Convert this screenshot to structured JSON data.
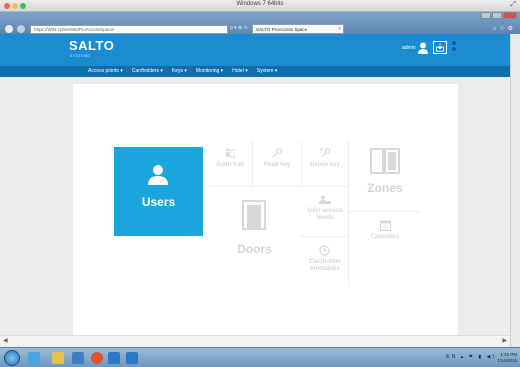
{
  "os": {
    "window_title": "Windows 7 64bits"
  },
  "browser": {
    "address": "https://WIN-zphee060/ProAccessSpace/",
    "address_tools": "ρ ▾ ⊗ ↻",
    "tab_title": "SALTO ProAccess Space",
    "tab_close": "×"
  },
  "header": {
    "logo": "SALTO",
    "logo_sub": "SYSTEMS",
    "user_name": "admin"
  },
  "menu": {
    "items": [
      "Access points ▾",
      "Cardholders ▾",
      "Keys ▾",
      "Monitoring ▾",
      "Hotel ▾",
      "System ▾"
    ]
  },
  "dashboard": {
    "users": "Users",
    "audit_trail": "Audit trail",
    "read_key": "Read key",
    "delete_key": "Delete key",
    "zones": "Zones",
    "doors": "Doors",
    "user_access_levels": "User access levels",
    "calendars": "Calendars",
    "cardholder_timetables": "Cardholder timetables"
  },
  "taskbar": {
    "tray": "EN ▴ ⚑ ▮ ◀)",
    "time": "1:39 PM",
    "date": "7/14/2015"
  },
  "colors": {
    "header_blue": "#1a8ccf",
    "menu_blue": "#0f6fae",
    "users_tile": "#1aa6dd"
  }
}
